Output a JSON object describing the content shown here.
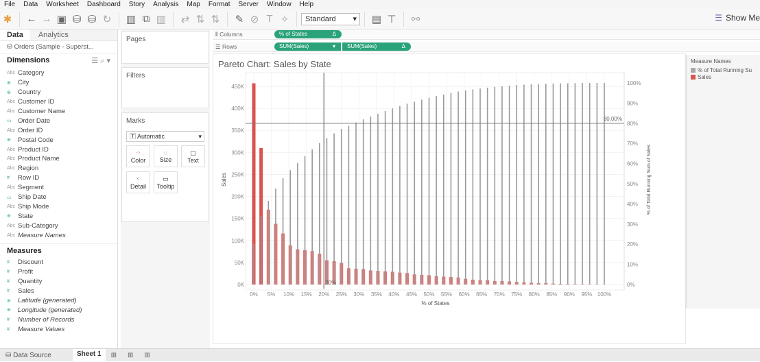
{
  "menu": [
    "File",
    "Data",
    "Worksheet",
    "Dashboard",
    "Story",
    "Analysis",
    "Map",
    "Format",
    "Server",
    "Window",
    "Help"
  ],
  "toolbar": {
    "fit": "Standard",
    "show_me": "Show Me"
  },
  "left": {
    "tab_data": "Data",
    "tab_analytics": "Analytics",
    "datasource": "Orders (Sample - Superst...",
    "dimensions_label": "Dimensions",
    "dimensions": [
      {
        "n": "Category",
        "t": "abc"
      },
      {
        "n": "City",
        "t": "geo"
      },
      {
        "n": "Country",
        "t": "geo"
      },
      {
        "n": "Customer ID",
        "t": "abc"
      },
      {
        "n": "Customer Name",
        "t": "abc"
      },
      {
        "n": "Order Date",
        "t": "date"
      },
      {
        "n": "Order ID",
        "t": "abc"
      },
      {
        "n": "Postal Code",
        "t": "geo"
      },
      {
        "n": "Product ID",
        "t": "abc"
      },
      {
        "n": "Product Name",
        "t": "abc"
      },
      {
        "n": "Region",
        "t": "abc"
      },
      {
        "n": "Row ID",
        "t": "num"
      },
      {
        "n": "Segment",
        "t": "abc"
      },
      {
        "n": "Ship Date",
        "t": "date"
      },
      {
        "n": "Ship Mode",
        "t": "abc"
      },
      {
        "n": "State",
        "t": "geo"
      },
      {
        "n": "Sub-Category",
        "t": "abc"
      },
      {
        "n": "Measure Names",
        "t": "abc",
        "i": true
      }
    ],
    "measures_label": "Measures",
    "measures": [
      {
        "n": "Discount",
        "t": "num"
      },
      {
        "n": "Profit",
        "t": "num"
      },
      {
        "n": "Quantity",
        "t": "num"
      },
      {
        "n": "Sales",
        "t": "num"
      },
      {
        "n": "Latitude (generated)",
        "t": "geo",
        "i": true
      },
      {
        "n": "Longitude (generated)",
        "t": "geo",
        "i": true
      },
      {
        "n": "Number of Records",
        "t": "num",
        "i": true
      },
      {
        "n": "Measure Values",
        "t": "num",
        "i": true
      }
    ]
  },
  "cards": {
    "pages": "Pages",
    "filters": "Filters",
    "marks": "Marks",
    "mark_type": "Automatic",
    "color": "Color",
    "size": "Size",
    "text": "Text",
    "detail": "Detail",
    "tooltip": "Tooltip"
  },
  "shelves": {
    "columns": "Columns",
    "rows": "Rows",
    "col_pill": "% of States",
    "row_pill1": "SUM(Sales)",
    "row_pill2": "SUM(Sales)"
  },
  "legend": {
    "title": "Measure Names",
    "items": [
      {
        "label": "% of Total Running Su",
        "color": "#a9a9a9"
      },
      {
        "label": "Sales",
        "color": "#d9534f"
      }
    ]
  },
  "bottom": {
    "datasource": "Data Source",
    "sheet": "Sheet 1"
  },
  "chart_data": {
    "type": "bar",
    "title": "Pareto Chart: Sales by State",
    "xlabel": "% of States",
    "ylabel": "Sales",
    "y2label": "% of Total Running Sum of Sales",
    "xticks": [
      "0%",
      "5%",
      "10%",
      "15%",
      "20%",
      "25%",
      "30%",
      "35%",
      "40%",
      "45%",
      "50%",
      "55%",
      "60%",
      "65%",
      "70%",
      "75%",
      "80%",
      "85%",
      "90%",
      "95%",
      "100%"
    ],
    "yticks": [
      "0K",
      "50K",
      "100K",
      "150K",
      "200K",
      "250K",
      "300K",
      "350K",
      "400K",
      "450K"
    ],
    "y2ticks": [
      "0%",
      "10%",
      "20%",
      "30%",
      "40%",
      "50%",
      "60%",
      "70%",
      "80%",
      "90%",
      "100%"
    ],
    "ylim": [
      0,
      450000
    ],
    "y2lim": [
      0,
      1
    ],
    "ref_x_label": "20%",
    "ref_y_label": "80.00%",
    "ref_x": 0.2,
    "ref_y": 0.8,
    "series": [
      {
        "name": "Sales",
        "color": "#d9534f",
        "values": [
          457,
          310,
          170,
          138,
          116,
          89,
          80,
          78,
          76,
          70,
          55,
          53,
          49,
          37,
          36,
          35,
          32,
          31,
          30,
          29,
          27,
          26,
          23,
          22,
          21,
          19,
          18,
          17,
          16,
          13,
          11,
          10,
          10,
          8,
          8,
          7,
          6,
          5,
          4,
          3,
          3,
          2,
          1.5,
          1.3,
          1,
          0.9,
          0.7,
          0.5,
          0.3
        ],
        "unit": "K"
      },
      {
        "name": "% of Total Running Sum of Sales",
        "color": "#a9a9a9",
        "derived": "running sum of Sales / total"
      }
    ]
  }
}
